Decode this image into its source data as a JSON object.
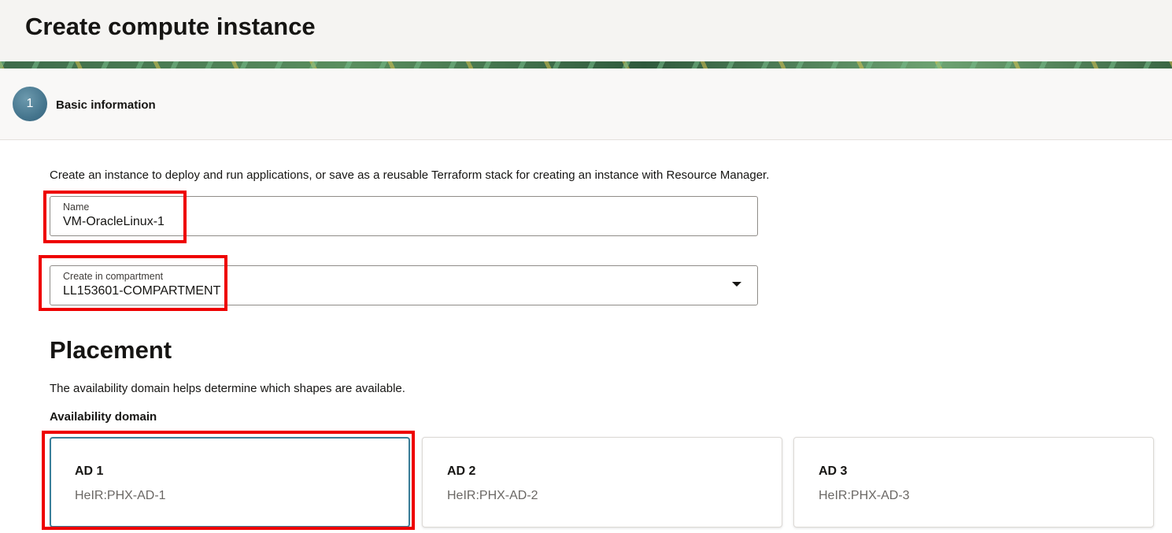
{
  "page": {
    "title": "Create compute instance"
  },
  "stepper": {
    "current_step_number": "1",
    "current_step_label": "Basic information"
  },
  "basic_info": {
    "intro_text": "Create an instance to deploy and run applications, or save as a reusable Terraform stack for creating an instance with Resource Manager.",
    "name_field": {
      "label": "Name",
      "value": "VM-OracleLinux-1"
    },
    "compartment_field": {
      "label": "Create in compartment",
      "value": "LL153601-COMPARTMENT"
    }
  },
  "placement": {
    "title": "Placement",
    "description": "The availability domain helps determine which shapes are available.",
    "availability_domain_label": "Availability domain",
    "domains": [
      {
        "name": "AD 1",
        "id": "HeIR:PHX-AD-1",
        "selected": true
      },
      {
        "name": "AD 2",
        "id": "HeIR:PHX-AD-2",
        "selected": false
      },
      {
        "name": "AD 3",
        "id": "HeIR:PHX-AD-3",
        "selected": false
      }
    ]
  },
  "colors": {
    "highlight": "#ee0000",
    "selected_border": "#3a7f9a",
    "step_circle": "#46768e"
  }
}
